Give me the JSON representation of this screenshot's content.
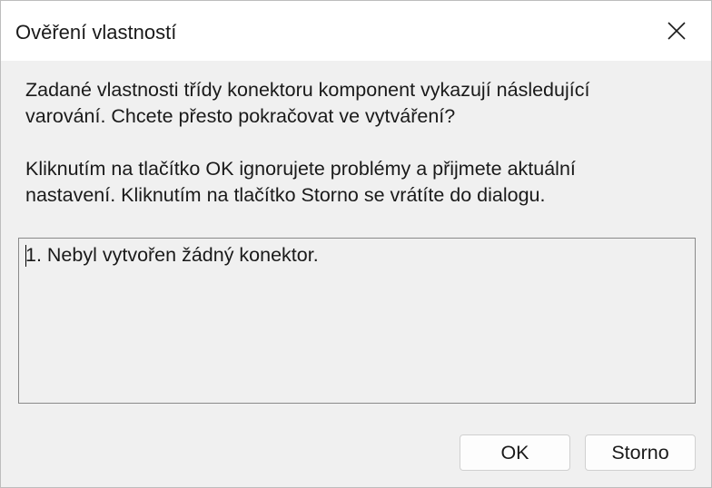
{
  "dialog": {
    "title": "Ověření vlastností",
    "close_icon": "close-icon"
  },
  "message": {
    "line1": "Zadané vlastnosti třídy konektoru komponent vykazují následující",
    "line2": "varování. Chcete přesto pokračovat ve vytváření?",
    "line3": "Kliknutím na tlačítko OK ignorujete problémy a přijmete aktuální",
    "line4": "nastavení. Kliknutím na tlačítko Storno se vrátíte do dialogu."
  },
  "warnings": {
    "items": [
      "1. Nebyl vytvořen žádný konektor."
    ]
  },
  "buttons": {
    "ok_label": "OK",
    "cancel_label": "Storno"
  }
}
